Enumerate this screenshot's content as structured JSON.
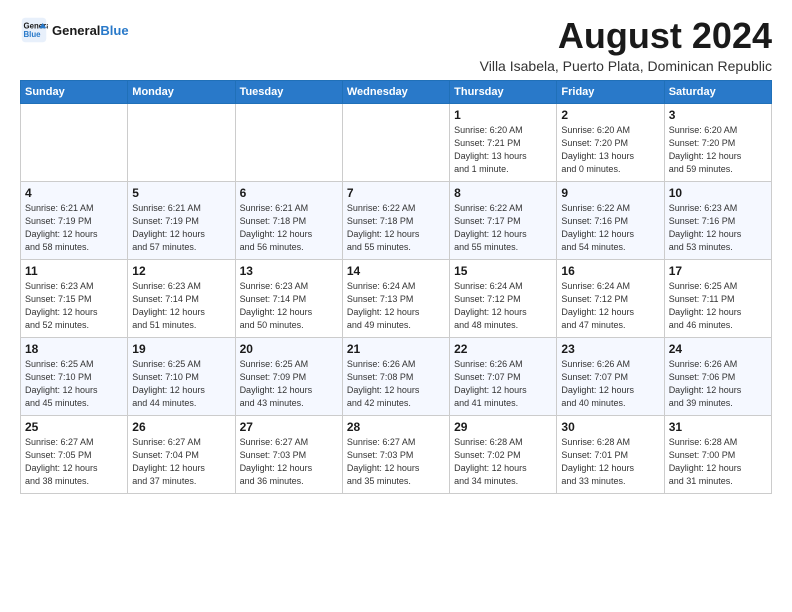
{
  "logo": {
    "line1": "General",
    "line2": "Blue"
  },
  "title": "August 2024",
  "subtitle": "Villa Isabela, Puerto Plata, Dominican Republic",
  "days_header": [
    "Sunday",
    "Monday",
    "Tuesday",
    "Wednesday",
    "Thursday",
    "Friday",
    "Saturday"
  ],
  "weeks": [
    [
      {
        "num": "",
        "info": ""
      },
      {
        "num": "",
        "info": ""
      },
      {
        "num": "",
        "info": ""
      },
      {
        "num": "",
        "info": ""
      },
      {
        "num": "1",
        "info": "Sunrise: 6:20 AM\nSunset: 7:21 PM\nDaylight: 13 hours\nand 1 minute."
      },
      {
        "num": "2",
        "info": "Sunrise: 6:20 AM\nSunset: 7:20 PM\nDaylight: 13 hours\nand 0 minutes."
      },
      {
        "num": "3",
        "info": "Sunrise: 6:20 AM\nSunset: 7:20 PM\nDaylight: 12 hours\nand 59 minutes."
      }
    ],
    [
      {
        "num": "4",
        "info": "Sunrise: 6:21 AM\nSunset: 7:19 PM\nDaylight: 12 hours\nand 58 minutes."
      },
      {
        "num": "5",
        "info": "Sunrise: 6:21 AM\nSunset: 7:19 PM\nDaylight: 12 hours\nand 57 minutes."
      },
      {
        "num": "6",
        "info": "Sunrise: 6:21 AM\nSunset: 7:18 PM\nDaylight: 12 hours\nand 56 minutes."
      },
      {
        "num": "7",
        "info": "Sunrise: 6:22 AM\nSunset: 7:18 PM\nDaylight: 12 hours\nand 55 minutes."
      },
      {
        "num": "8",
        "info": "Sunrise: 6:22 AM\nSunset: 7:17 PM\nDaylight: 12 hours\nand 55 minutes."
      },
      {
        "num": "9",
        "info": "Sunrise: 6:22 AM\nSunset: 7:16 PM\nDaylight: 12 hours\nand 54 minutes."
      },
      {
        "num": "10",
        "info": "Sunrise: 6:23 AM\nSunset: 7:16 PM\nDaylight: 12 hours\nand 53 minutes."
      }
    ],
    [
      {
        "num": "11",
        "info": "Sunrise: 6:23 AM\nSunset: 7:15 PM\nDaylight: 12 hours\nand 52 minutes."
      },
      {
        "num": "12",
        "info": "Sunrise: 6:23 AM\nSunset: 7:14 PM\nDaylight: 12 hours\nand 51 minutes."
      },
      {
        "num": "13",
        "info": "Sunrise: 6:23 AM\nSunset: 7:14 PM\nDaylight: 12 hours\nand 50 minutes."
      },
      {
        "num": "14",
        "info": "Sunrise: 6:24 AM\nSunset: 7:13 PM\nDaylight: 12 hours\nand 49 minutes."
      },
      {
        "num": "15",
        "info": "Sunrise: 6:24 AM\nSunset: 7:12 PM\nDaylight: 12 hours\nand 48 minutes."
      },
      {
        "num": "16",
        "info": "Sunrise: 6:24 AM\nSunset: 7:12 PM\nDaylight: 12 hours\nand 47 minutes."
      },
      {
        "num": "17",
        "info": "Sunrise: 6:25 AM\nSunset: 7:11 PM\nDaylight: 12 hours\nand 46 minutes."
      }
    ],
    [
      {
        "num": "18",
        "info": "Sunrise: 6:25 AM\nSunset: 7:10 PM\nDaylight: 12 hours\nand 45 minutes."
      },
      {
        "num": "19",
        "info": "Sunrise: 6:25 AM\nSunset: 7:10 PM\nDaylight: 12 hours\nand 44 minutes."
      },
      {
        "num": "20",
        "info": "Sunrise: 6:25 AM\nSunset: 7:09 PM\nDaylight: 12 hours\nand 43 minutes."
      },
      {
        "num": "21",
        "info": "Sunrise: 6:26 AM\nSunset: 7:08 PM\nDaylight: 12 hours\nand 42 minutes."
      },
      {
        "num": "22",
        "info": "Sunrise: 6:26 AM\nSunset: 7:07 PM\nDaylight: 12 hours\nand 41 minutes."
      },
      {
        "num": "23",
        "info": "Sunrise: 6:26 AM\nSunset: 7:07 PM\nDaylight: 12 hours\nand 40 minutes."
      },
      {
        "num": "24",
        "info": "Sunrise: 6:26 AM\nSunset: 7:06 PM\nDaylight: 12 hours\nand 39 minutes."
      }
    ],
    [
      {
        "num": "25",
        "info": "Sunrise: 6:27 AM\nSunset: 7:05 PM\nDaylight: 12 hours\nand 38 minutes."
      },
      {
        "num": "26",
        "info": "Sunrise: 6:27 AM\nSunset: 7:04 PM\nDaylight: 12 hours\nand 37 minutes."
      },
      {
        "num": "27",
        "info": "Sunrise: 6:27 AM\nSunset: 7:03 PM\nDaylight: 12 hours\nand 36 minutes."
      },
      {
        "num": "28",
        "info": "Sunrise: 6:27 AM\nSunset: 7:03 PM\nDaylight: 12 hours\nand 35 minutes."
      },
      {
        "num": "29",
        "info": "Sunrise: 6:28 AM\nSunset: 7:02 PM\nDaylight: 12 hours\nand 34 minutes."
      },
      {
        "num": "30",
        "info": "Sunrise: 6:28 AM\nSunset: 7:01 PM\nDaylight: 12 hours\nand 33 minutes."
      },
      {
        "num": "31",
        "info": "Sunrise: 6:28 AM\nSunset: 7:00 PM\nDaylight: 12 hours\nand 31 minutes."
      }
    ]
  ]
}
